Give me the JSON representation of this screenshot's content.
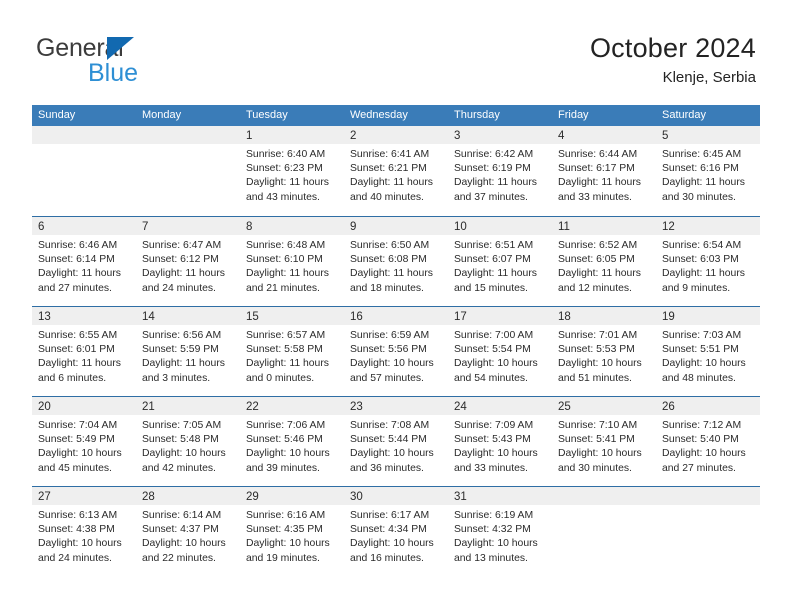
{
  "brand": {
    "name_top": "General",
    "name_bottom": "Blue",
    "color_dark": "#3c3c3c",
    "color_blue": "#2e8fd4",
    "triangle_color": "#1269b0"
  },
  "header": {
    "title": "October 2024",
    "subtitle": "Klenje, Serbia"
  },
  "theme": {
    "header_row_bg": "#3a7cb8",
    "row_divider": "#2f6ea5",
    "day_band_bg": "#efefef",
    "text": "#2b2b2b"
  },
  "weekdays": [
    "Sunday",
    "Monday",
    "Tuesday",
    "Wednesday",
    "Thursday",
    "Friday",
    "Saturday"
  ],
  "labels": {
    "sunrise_prefix": "Sunrise: ",
    "sunset_prefix": "Sunset: ",
    "daylight_prefix": "Daylight: "
  },
  "weeks": [
    [
      {
        "day": "",
        "empty": true
      },
      {
        "day": "",
        "empty": true
      },
      {
        "day": "1",
        "sunrise": "Sunrise: 6:40 AM",
        "sunset": "Sunset: 6:23 PM",
        "daylight_1": "Daylight: 11 hours",
        "daylight_2": "and 43 minutes."
      },
      {
        "day": "2",
        "sunrise": "Sunrise: 6:41 AM",
        "sunset": "Sunset: 6:21 PM",
        "daylight_1": "Daylight: 11 hours",
        "daylight_2": "and 40 minutes."
      },
      {
        "day": "3",
        "sunrise": "Sunrise: 6:42 AM",
        "sunset": "Sunset: 6:19 PM",
        "daylight_1": "Daylight: 11 hours",
        "daylight_2": "and 37 minutes."
      },
      {
        "day": "4",
        "sunrise": "Sunrise: 6:44 AM",
        "sunset": "Sunset: 6:17 PM",
        "daylight_1": "Daylight: 11 hours",
        "daylight_2": "and 33 minutes."
      },
      {
        "day": "5",
        "sunrise": "Sunrise: 6:45 AM",
        "sunset": "Sunset: 6:16 PM",
        "daylight_1": "Daylight: 11 hours",
        "daylight_2": "and 30 minutes."
      }
    ],
    [
      {
        "day": "6",
        "sunrise": "Sunrise: 6:46 AM",
        "sunset": "Sunset: 6:14 PM",
        "daylight_1": "Daylight: 11 hours",
        "daylight_2": "and 27 minutes."
      },
      {
        "day": "7",
        "sunrise": "Sunrise: 6:47 AM",
        "sunset": "Sunset: 6:12 PM",
        "daylight_1": "Daylight: 11 hours",
        "daylight_2": "and 24 minutes."
      },
      {
        "day": "8",
        "sunrise": "Sunrise: 6:48 AM",
        "sunset": "Sunset: 6:10 PM",
        "daylight_1": "Daylight: 11 hours",
        "daylight_2": "and 21 minutes."
      },
      {
        "day": "9",
        "sunrise": "Sunrise: 6:50 AM",
        "sunset": "Sunset: 6:08 PM",
        "daylight_1": "Daylight: 11 hours",
        "daylight_2": "and 18 minutes."
      },
      {
        "day": "10",
        "sunrise": "Sunrise: 6:51 AM",
        "sunset": "Sunset: 6:07 PM",
        "daylight_1": "Daylight: 11 hours",
        "daylight_2": "and 15 minutes."
      },
      {
        "day": "11",
        "sunrise": "Sunrise: 6:52 AM",
        "sunset": "Sunset: 6:05 PM",
        "daylight_1": "Daylight: 11 hours",
        "daylight_2": "and 12 minutes."
      },
      {
        "day": "12",
        "sunrise": "Sunrise: 6:54 AM",
        "sunset": "Sunset: 6:03 PM",
        "daylight_1": "Daylight: 11 hours",
        "daylight_2": "and 9 minutes."
      }
    ],
    [
      {
        "day": "13",
        "sunrise": "Sunrise: 6:55 AM",
        "sunset": "Sunset: 6:01 PM",
        "daylight_1": "Daylight: 11 hours",
        "daylight_2": "and 6 minutes."
      },
      {
        "day": "14",
        "sunrise": "Sunrise: 6:56 AM",
        "sunset": "Sunset: 5:59 PM",
        "daylight_1": "Daylight: 11 hours",
        "daylight_2": "and 3 minutes."
      },
      {
        "day": "15",
        "sunrise": "Sunrise: 6:57 AM",
        "sunset": "Sunset: 5:58 PM",
        "daylight_1": "Daylight: 11 hours",
        "daylight_2": "and 0 minutes."
      },
      {
        "day": "16",
        "sunrise": "Sunrise: 6:59 AM",
        "sunset": "Sunset: 5:56 PM",
        "daylight_1": "Daylight: 10 hours",
        "daylight_2": "and 57 minutes."
      },
      {
        "day": "17",
        "sunrise": "Sunrise: 7:00 AM",
        "sunset": "Sunset: 5:54 PM",
        "daylight_1": "Daylight: 10 hours",
        "daylight_2": "and 54 minutes."
      },
      {
        "day": "18",
        "sunrise": "Sunrise: 7:01 AM",
        "sunset": "Sunset: 5:53 PM",
        "daylight_1": "Daylight: 10 hours",
        "daylight_2": "and 51 minutes."
      },
      {
        "day": "19",
        "sunrise": "Sunrise: 7:03 AM",
        "sunset": "Sunset: 5:51 PM",
        "daylight_1": "Daylight: 10 hours",
        "daylight_2": "and 48 minutes."
      }
    ],
    [
      {
        "day": "20",
        "sunrise": "Sunrise: 7:04 AM",
        "sunset": "Sunset: 5:49 PM",
        "daylight_1": "Daylight: 10 hours",
        "daylight_2": "and 45 minutes."
      },
      {
        "day": "21",
        "sunrise": "Sunrise: 7:05 AM",
        "sunset": "Sunset: 5:48 PM",
        "daylight_1": "Daylight: 10 hours",
        "daylight_2": "and 42 minutes."
      },
      {
        "day": "22",
        "sunrise": "Sunrise: 7:06 AM",
        "sunset": "Sunset: 5:46 PM",
        "daylight_1": "Daylight: 10 hours",
        "daylight_2": "and 39 minutes."
      },
      {
        "day": "23",
        "sunrise": "Sunrise: 7:08 AM",
        "sunset": "Sunset: 5:44 PM",
        "daylight_1": "Daylight: 10 hours",
        "daylight_2": "and 36 minutes."
      },
      {
        "day": "24",
        "sunrise": "Sunrise: 7:09 AM",
        "sunset": "Sunset: 5:43 PM",
        "daylight_1": "Daylight: 10 hours",
        "daylight_2": "and 33 minutes."
      },
      {
        "day": "25",
        "sunrise": "Sunrise: 7:10 AM",
        "sunset": "Sunset: 5:41 PM",
        "daylight_1": "Daylight: 10 hours",
        "daylight_2": "and 30 minutes."
      },
      {
        "day": "26",
        "sunrise": "Sunrise: 7:12 AM",
        "sunset": "Sunset: 5:40 PM",
        "daylight_1": "Daylight: 10 hours",
        "daylight_2": "and 27 minutes."
      }
    ],
    [
      {
        "day": "27",
        "sunrise": "Sunrise: 6:13 AM",
        "sunset": "Sunset: 4:38 PM",
        "daylight_1": "Daylight: 10 hours",
        "daylight_2": "and 24 minutes."
      },
      {
        "day": "28",
        "sunrise": "Sunrise: 6:14 AM",
        "sunset": "Sunset: 4:37 PM",
        "daylight_1": "Daylight: 10 hours",
        "daylight_2": "and 22 minutes."
      },
      {
        "day": "29",
        "sunrise": "Sunrise: 6:16 AM",
        "sunset": "Sunset: 4:35 PM",
        "daylight_1": "Daylight: 10 hours",
        "daylight_2": "and 19 minutes."
      },
      {
        "day": "30",
        "sunrise": "Sunrise: 6:17 AM",
        "sunset": "Sunset: 4:34 PM",
        "daylight_1": "Daylight: 10 hours",
        "daylight_2": "and 16 minutes."
      },
      {
        "day": "31",
        "sunrise": "Sunrise: 6:19 AM",
        "sunset": "Sunset: 4:32 PM",
        "daylight_1": "Daylight: 10 hours",
        "daylight_2": "and 13 minutes."
      },
      {
        "day": "",
        "empty": true
      },
      {
        "day": "",
        "empty": true
      }
    ]
  ]
}
